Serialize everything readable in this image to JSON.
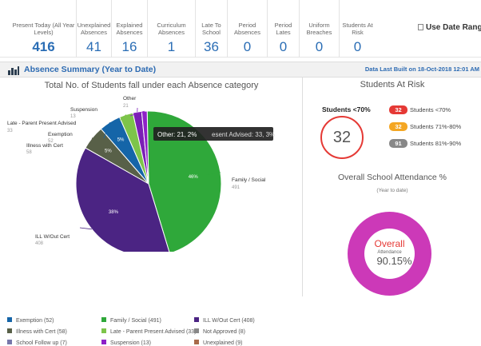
{
  "stats": [
    {
      "label": "Present Today (All Year Levels)",
      "value": "416"
    },
    {
      "label": "Unexplained Absences",
      "value": "41"
    },
    {
      "label": "Explained Absences",
      "value": "16"
    },
    {
      "label": "Curriculum Absences",
      "value": "1"
    },
    {
      "label": "Late To School",
      "value": "36"
    },
    {
      "label": "Period Absences",
      "value": "0"
    },
    {
      "label": "Period Lates",
      "value": "0"
    },
    {
      "label": "Uniform Breaches",
      "value": "0"
    },
    {
      "label": "Students At Risk",
      "value": "0"
    }
  ],
  "date_range_label": "Use Date Range",
  "section": {
    "title": "Absence Summary (Year to Date)",
    "built": "Data Last Built on 18-Oct-2018 12:01 AM"
  },
  "chart_data": {
    "type": "pie",
    "title": "Total No. of Students fall under each Absence category",
    "slices": [
      {
        "name": "Family / Social",
        "value": 491,
        "pct": "46%",
        "label": "Family / Social",
        "color": "#2fa83a"
      },
      {
        "name": "ILL W/Out Cert",
        "value": 408,
        "pct": "38%",
        "label": "ILL W/Out Cert",
        "color": "#4b2483"
      },
      {
        "name": "Illness with Cert",
        "value": 58,
        "pct": "5%",
        "label": "Illness with Cert",
        "color": "#586048"
      },
      {
        "name": "Exemption",
        "value": 52,
        "pct": "5%",
        "label": "Exemption",
        "color": "#1565a8"
      },
      {
        "name": "Late - Parent Present Advised",
        "value": 33,
        "pct": "3%",
        "label": "Late - Parent Present Advised",
        "color": "#7dc44a"
      },
      {
        "name": "Other",
        "value": 21,
        "pct": "2%",
        "label": "Other",
        "color": "#7a1fb5"
      },
      {
        "name": "Suspension",
        "value": 13,
        "pct": "1%",
        "label": "Suspension",
        "color": "#8e20c8"
      }
    ],
    "tooltip_text": "Other: 21, 2%",
    "tooltip_behind": "esent Advised: 33, 3%"
  },
  "legend": [
    {
      "label": "Exemption",
      "count": "(52)",
      "color": "#1565a8"
    },
    {
      "label": "Family / Social",
      "count": "(491)",
      "color": "#2fa83a"
    },
    {
      "label": "ILL W/Out Cert",
      "count": "(408)",
      "color": "#4b2483"
    },
    {
      "label": "Illness with Cert",
      "count": "(58)",
      "color": "#586048"
    },
    {
      "label": "Late - Parent Present Advised",
      "count": "(33)",
      "color": "#7dc44a"
    },
    {
      "label": "Not Approved",
      "count": "(8)",
      "color": "#888888"
    },
    {
      "label": "School Follow up",
      "count": "(7)",
      "color": "#7777aa"
    },
    {
      "label": "Suspension",
      "count": "(13)",
      "color": "#8e20c8"
    },
    {
      "label": "Unexplained",
      "count": "(9)",
      "color": "#a86a4a"
    }
  ],
  "at_risk": {
    "title": "Students At Risk",
    "sub": "Students <70%",
    "total": "32",
    "rows": [
      {
        "count": "32",
        "label": "Students <70%",
        "color": "#e53935"
      },
      {
        "count": "32",
        "label": "Students 71%-80%",
        "color": "#f4a623"
      },
      {
        "count": "91",
        "label": "Students 81%-90%",
        "color": "#888888"
      }
    ]
  },
  "attendance": {
    "title": "Overall School Attendance %",
    "sub": "(Year to date)",
    "label": "Overall",
    "sublabel": "Attendance",
    "value": "90.15%"
  }
}
